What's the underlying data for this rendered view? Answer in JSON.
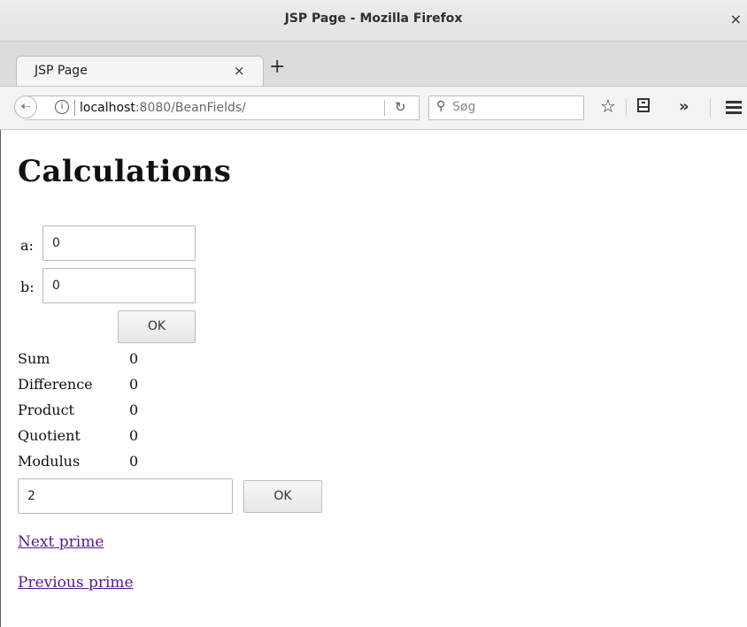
{
  "window": {
    "title": "JSP Page - Mozilla Firefox",
    "close_glyph": "×"
  },
  "tabs": [
    {
      "label": "JSP Page",
      "close_glyph": "×"
    }
  ],
  "new_tab_glyph": "+",
  "navbar": {
    "url_host": "localhost",
    "url_rest": ":8080/BeanFields/",
    "search_placeholder": "Søg",
    "icons": [
      "back-icon",
      "info-icon",
      "reload-icon",
      "search-icon",
      "star-icon",
      "library-icon",
      "overflow-icon",
      "menu-icon"
    ]
  },
  "page": {
    "heading": "Calculations",
    "field_a": {
      "label": "a:",
      "value": "0"
    },
    "field_b": {
      "label": "b:",
      "value": "0"
    },
    "ok_label": "OK",
    "results": [
      {
        "label": "Sum",
        "value": "0"
      },
      {
        "label": "Difference",
        "value": "0"
      },
      {
        "label": "Product",
        "value": "0"
      },
      {
        "label": "Quotient",
        "value": "0"
      },
      {
        "label": "Modulus",
        "value": "0"
      }
    ],
    "prime_input_value": "2",
    "prime_ok_label": "OK",
    "links": {
      "next_prime": "Next prime",
      "previous_prime": "Previous prime"
    },
    "link_color": "#551a8b"
  }
}
